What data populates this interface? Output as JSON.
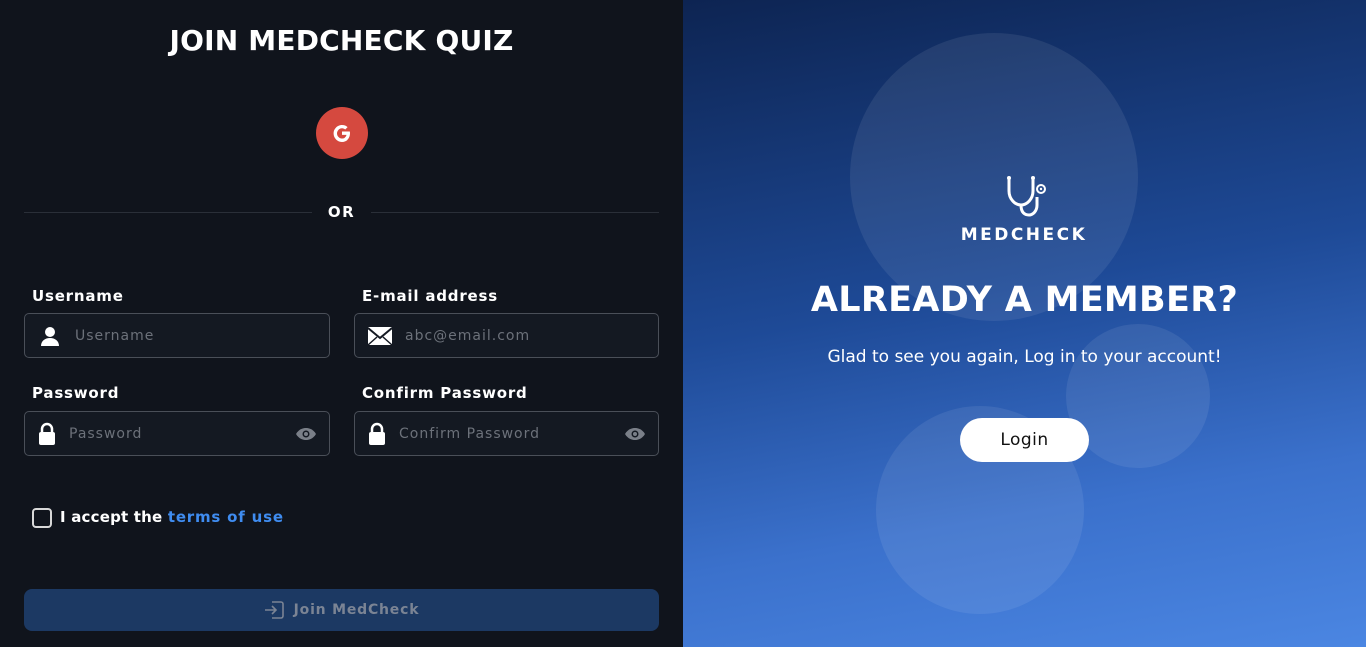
{
  "signup": {
    "title": "JOIN MEDCHECK QUIZ",
    "google_icon": "google-icon",
    "or_text": "OR",
    "username": {
      "label": "Username",
      "placeholder": "Username",
      "icon": "user-icon"
    },
    "email": {
      "label": "E-mail address",
      "placeholder": "abc@email.com",
      "icon": "envelope-icon"
    },
    "password": {
      "label": "Password",
      "placeholder": "Password",
      "icon": "lock-icon"
    },
    "confirm_password": {
      "label": "Confirm Password",
      "placeholder": "Confirm Password",
      "icon": "lock-icon"
    },
    "terms": {
      "prefix": "I accept the ",
      "link": "terms of use"
    },
    "join_button": "Join MedCheck"
  },
  "login_panel": {
    "logo_text": "MEDCHECK",
    "headline": "ALREADY A MEMBER?",
    "subtitle": "Glad to see you again, Log in to your account!",
    "login_button": "Login"
  },
  "colors": {
    "left_bg": "#10141c",
    "google_red": "#d5493f",
    "link_blue": "#3f8cf0",
    "join_bg": "#1c3963",
    "right_gradient_top": "#0d2452",
    "right_gradient_bottom": "#4b86e2"
  }
}
